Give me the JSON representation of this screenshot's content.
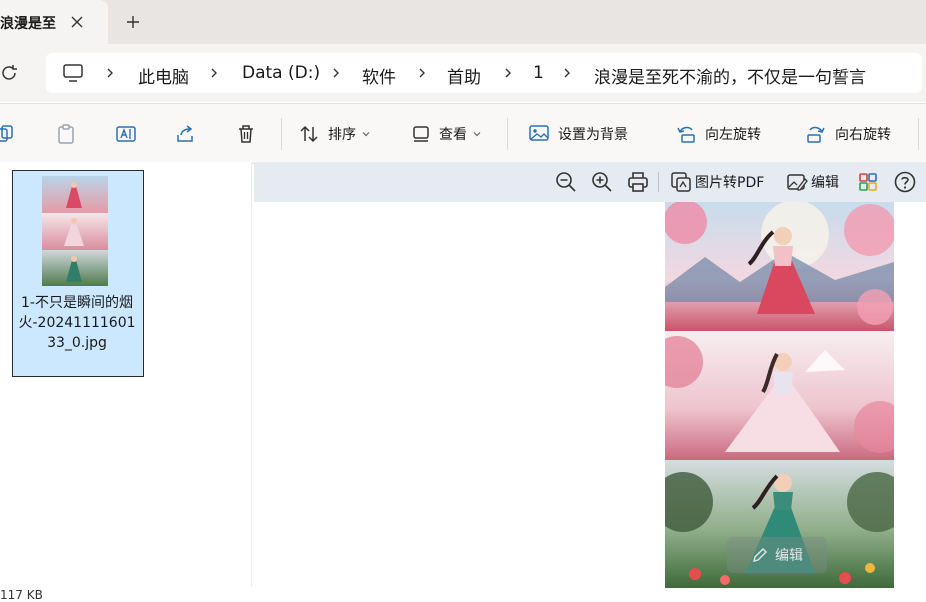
{
  "tab": {
    "title": "浪漫是至死不渝的，不仅是一句誓言"
  },
  "breadcrumb": {
    "items": [
      "此电脑",
      "Data (D:)",
      "软件",
      "首助",
      "1",
      "浪漫是至死不渝的，不仅是一句誓言"
    ]
  },
  "commands": {
    "sort": "排序",
    "view": "查看",
    "set_background": "设置为背景",
    "rotate_left": "向左旋转",
    "rotate_right": "向右旋转"
  },
  "file": {
    "name": "1-不只是瞬间的烟火-2024111160133_0.jpg"
  },
  "preview_toolbar": {
    "to_pdf": "图片转PDF",
    "edit": "编辑"
  },
  "overlay": {
    "edit": "编辑"
  },
  "status": {
    "size": "117 KB"
  }
}
